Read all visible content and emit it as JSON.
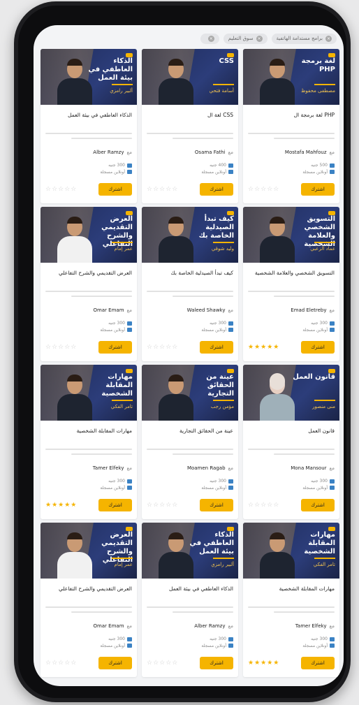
{
  "filter_tags": [
    {
      "label": "برامج مستدامة الهاتفية"
    },
    {
      "label": "سوق التعليم"
    },
    {
      "label": ""
    }
  ],
  "cards": [
    {
      "thumb_title": "لغة برمجة PHP",
      "thumb_sub": "مصطفى محفوظ",
      "title": "PHP لغة برمجة ال",
      "instructor": "Mostafa Mahfouz",
      "price": "500 جنيه",
      "mode": "أونلاين مسجلة",
      "stars": "☆☆☆☆☆",
      "rated": false,
      "cta": "اشترك",
      "style": "plain"
    },
    {
      "thumb_title": "CSS",
      "thumb_sub": "أسامة فتحي",
      "title": "CSS لغة ال",
      "instructor": "Osama Fathi",
      "price": "400 جنيه",
      "mode": "أونلاين مسجلة",
      "stars": "☆☆☆☆☆",
      "rated": false,
      "cta": "اشترك",
      "style": "plain"
    },
    {
      "thumb_title": "الذكاء العاطفي في بيئة العمل",
      "thumb_sub": "ألبير رامزي",
      "title": "الذكاء العاطفي في بيئة العمل",
      "instructor": "Alber Ramzy",
      "price": "300 جنيه",
      "mode": "أونلاين مسجلة",
      "stars": "☆☆☆☆☆",
      "rated": false,
      "cta": "اشترك",
      "style": "plain"
    },
    {
      "thumb_title": "التسويق الشخصي والعلامة الشخصية",
      "thumb_sub": "عماد الزعبي",
      "title": "التسويق الشخصي والعلامة الشخصية",
      "instructor": "Emad Eletreby",
      "price": "300 جنيه",
      "mode": "أونلاين مسجلة",
      "stars": "★★★★★",
      "rated": true,
      "cta": "اشترك",
      "style": "plain"
    },
    {
      "thumb_title": "كيف تبدأ الصيدلية الخاصة بك",
      "thumb_sub": "وليد شوقي",
      "title": "كيف تبدأ الصيدلية الخاصة بك",
      "instructor": "Waleed Shawky",
      "price": "300 جنيه",
      "mode": "أونلاين مسجلة",
      "stars": "☆☆☆☆☆",
      "rated": false,
      "cta": "اشترك",
      "style": "plain"
    },
    {
      "thumb_title": "العرض التقديمي والشرح التفاعلي",
      "thumb_sub": "عمر إمام",
      "title": "العرض التقديمي والشرح التفاعلي",
      "instructor": "Omar Emam",
      "price": "300 جنيه",
      "mode": "أونلاين مسجلة",
      "stars": "☆☆☆☆☆",
      "rated": false,
      "cta": "اشترك",
      "style": "white"
    },
    {
      "thumb_title": "قانون العمل",
      "thumb_sub": "منى منصور",
      "title": "قانون العمل",
      "instructor": "Mona Mansour",
      "price": "300 جنيه",
      "mode": "أونلاين مسجلة",
      "stars": "☆☆☆☆☆",
      "rated": false,
      "cta": "اشترك",
      "style": "hijab"
    },
    {
      "thumb_title": "عينة من الحقائق التجارية",
      "thumb_sub": "مؤمن رجب",
      "title": "عينة من الحقائق التجارية",
      "instructor": "Moamen Ragab",
      "price": "300 جنيه",
      "mode": "أونلاين مسجلة",
      "stars": "☆☆☆☆☆",
      "rated": false,
      "cta": "اشترك",
      "style": "plain"
    },
    {
      "thumb_title": "مهارات المقابلة الشخصية",
      "thumb_sub": "تامر الفكي",
      "title": "مهارات المقابلة الشخصية",
      "instructor": "Tamer Elfeky",
      "price": "300 جنيه",
      "mode": "أونلاين مسجلة",
      "stars": "★★★★★",
      "rated": true,
      "cta": "اشترك",
      "style": "plain"
    },
    {
      "thumb_title": "مهارات المقابلة الشخصية",
      "thumb_sub": "تامر الفكي",
      "title": "مهارات المقابلة الشخصية",
      "instructor": "Tamer Elfeky",
      "price": "300 جنيه",
      "mode": "أونلاين مسجلة",
      "stars": "★★★★★",
      "rated": true,
      "cta": "اشترك",
      "style": "plain"
    },
    {
      "thumb_title": "الذكاء العاطفي في بيئة العمل",
      "thumb_sub": "ألبير رامزي",
      "title": "الذكاء العاطفي في بيئة العمل",
      "instructor": "Alber Ramzy",
      "price": "300 جنيه",
      "mode": "أونلاين مسجلة",
      "stars": "☆☆☆☆☆",
      "rated": false,
      "cta": "اشترك",
      "style": "plain"
    },
    {
      "thumb_title": "العرض التقديمي والشرح التفاعلي",
      "thumb_sub": "عمر إمام",
      "title": "العرض التقديمي والشرح التفاعلي",
      "instructor": "Omar Emam",
      "price": "300 جنيه",
      "mode": "أونلاين مسجلة",
      "stars": "☆☆☆☆☆",
      "rated": false,
      "cta": "اشترك",
      "style": "white"
    }
  ],
  "labels": {
    "with": "مع"
  },
  "colors": {
    "accent": "#f5b400",
    "thumb_bg": "#1d2a57",
    "star_on": "#f5b400",
    "star_off": "#cfcfcf"
  },
  "icons": {
    "price": "price-tag-icon",
    "mode": "video-icon",
    "remove": "close-icon"
  }
}
